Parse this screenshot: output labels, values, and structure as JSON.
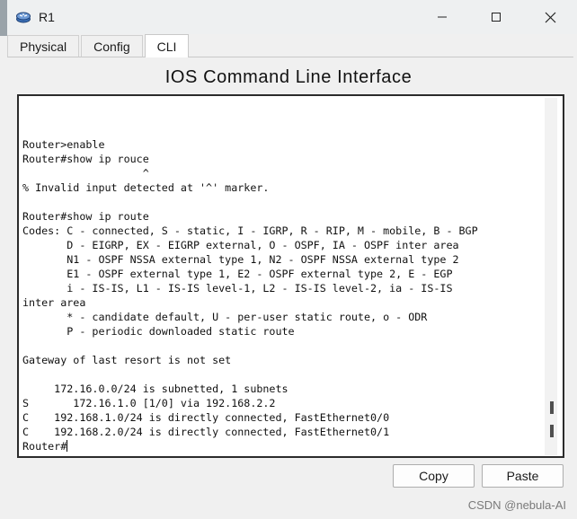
{
  "window": {
    "title": "R1",
    "controls": [
      "minimize-icon",
      "maximize-icon",
      "close-icon"
    ]
  },
  "tabs": [
    {
      "label": "Physical",
      "active": false
    },
    {
      "label": "Config",
      "active": false
    },
    {
      "label": "CLI",
      "active": true
    }
  ],
  "heading": "IOS Command Line Interface",
  "terminal": {
    "lines": [
      "Router>enable",
      "Router#show ip rouce",
      "                   ^",
      "% Invalid input detected at '^' marker.",
      "",
      "Router#show ip route",
      "Codes: C - connected, S - static, I - IGRP, R - RIP, M - mobile, B - BGP",
      "       D - EIGRP, EX - EIGRP external, O - OSPF, IA - OSPF inter area",
      "       N1 - OSPF NSSA external type 1, N2 - OSPF NSSA external type 2",
      "       E1 - OSPF external type 1, E2 - OSPF external type 2, E - EGP",
      "       i - IS-IS, L1 - IS-IS level-1, L2 - IS-IS level-2, ia - IS-IS",
      "inter area",
      "       * - candidate default, U - per-user static route, o - ODR",
      "       P - periodic downloaded static route",
      "",
      "Gateway of last resort is not set",
      "",
      "     172.16.0.0/24 is subnetted, 1 subnets",
      "S       172.16.1.0 [1/0] via 192.168.2.2",
      "C    192.168.1.0/24 is directly connected, FastEthernet0/0",
      "C    192.168.2.0/24 is directly connected, FastEthernet0/1"
    ],
    "prompt": "Router#"
  },
  "buttons": {
    "copy": "Copy",
    "paste": "Paste"
  },
  "watermark": "CSDN @nebula-AI",
  "colors": {
    "window_bg": "#f0f0f0",
    "terminal_bg": "#ffffff",
    "terminal_border": "#2b2b2b"
  }
}
